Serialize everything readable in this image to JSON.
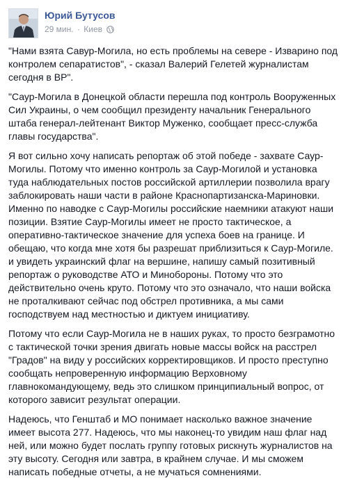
{
  "post": {
    "author": "Юрий Бутусов",
    "time": "29 мин.",
    "separator": "·",
    "location": "Киев",
    "privacy_icon": "globe-icon",
    "avatar_icon": "profile-photo",
    "paragraphs": [
      "\"Нами взята Савур-Могила, но есть проблемы на севере - Изварино под контролем сепаратистов\", - сказал Валерий Гелетей журналистам сегодня в ВР\".",
      "\"Саур-Могила в Донецкой области перешла под контроль Вооруженных Сил Украины, о чем сообщил президенту начальник Генерального штаба генерал-лейтенант Виктор Муженко, сообщает пресс-служба главы государства\".",
      "Я вот сильно хочу написать репортаж об этой победе - захвате Саур-Могилы. Потому что именно контроль за Саур-Могилой и установка туда наблюдательных постов российской артиллерии позволила врагу заблокировать наши части в районе Краснопартизанска-Мариновки. Именно по наводке с Саур-Могилы российские наемники атакуют наши позиции. Взятие Саур-Могилы имеет не просто тактическое, а оперативно-тактическое значение для успеха боев на границе. И обещаю, что когда мне хотя бы разрешат приблизиться к Саур-Могиле. и увидеть украинский флаг на вершине, напишу самый позитивный репортаж о руководстве АТО и Минобороны. Потому что это действительно очень круто. Потому что это означало, что наши войска не проталкивают сейчас под обстрел противника, а мы сами господствуем над местностью и диктуем инициативу.",
      "Потому что если Саур-Могила не в наших руках, то просто безграмотно с тактической точки зрения двигать новые массы войск на расстрел \"Градов\" на виду у российских корректировщиков. И просто преступно сообщать непроверенную информацию Верховному главнокомандующему, ведь это слишком принципиальный вопрос, от которого зависит результат операции.",
      "Надеюсь, что Генштаб и МО понимает насколько важное значение имеет высота 277. Надеюсь, что мы наконец-то увидим наш флаг над ней, или можно будет послать группу готовых рискнуть журналистов на эту высоту. Сегодня или завтра, в крайнем случае. И мы сможем написать победные отчеты, а не мучаться сомнениями."
    ]
  }
}
